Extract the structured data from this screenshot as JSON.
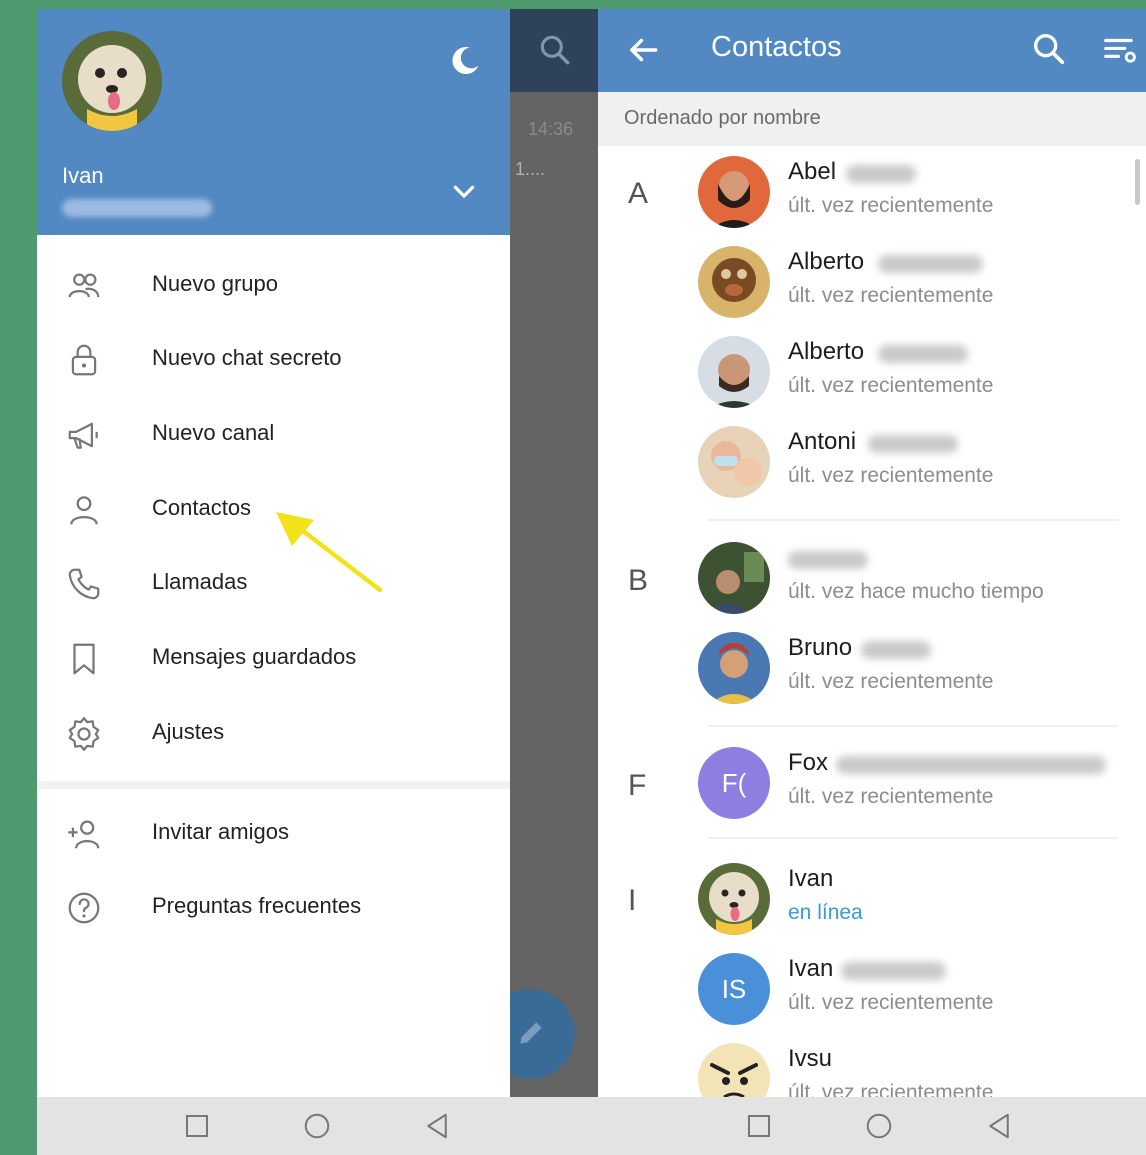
{
  "drawer": {
    "user_name": "Ivan",
    "menu_group_1": [
      {
        "label": "Nuevo grupo",
        "icon": "group-icon"
      },
      {
        "label": "Nuevo chat secreto",
        "icon": "lock-icon"
      },
      {
        "label": "Nuevo canal",
        "icon": "megaphone-icon"
      },
      {
        "label": "Contactos",
        "icon": "person-icon"
      },
      {
        "label": "Llamadas",
        "icon": "phone-icon"
      },
      {
        "label": "Mensajes guardados",
        "icon": "bookmark-icon"
      },
      {
        "label": "Ajustes",
        "icon": "gear-icon"
      }
    ],
    "menu_group_2": [
      {
        "label": "Invitar amigos",
        "icon": "add-person-icon"
      },
      {
        "label": "Preguntas frecuentes",
        "icon": "question-icon"
      }
    ]
  },
  "chat_peek": {
    "time": "14:36",
    "snippet": "1...."
  },
  "contacts": {
    "title": "Contactos",
    "sort_label": "Ordenado por nombre",
    "sections": [
      {
        "letter": "A",
        "items": [
          {
            "name": "Abel",
            "status": "últ. vez recientemente"
          },
          {
            "name": "Alberto",
            "status": "últ. vez recientemente"
          },
          {
            "name": "Alberto",
            "status": "últ. vez recientemente"
          },
          {
            "name": "Antoni",
            "status": "últ. vez recientemente"
          }
        ]
      },
      {
        "letter": "B",
        "items": [
          {
            "name": "",
            "status": "últ. vez hace mucho tiempo"
          },
          {
            "name": "Bruno",
            "status": "últ. vez recientemente"
          }
        ]
      },
      {
        "letter": "F",
        "items": [
          {
            "name": "Fox",
            "status": "últ. vez recientemente",
            "initials": "F(",
            "avatar_color": "#8e7ee0"
          }
        ]
      },
      {
        "letter": "I",
        "items": [
          {
            "name": "Ivan",
            "status": "en línea"
          },
          {
            "name": "Ivan",
            "status": "últ. vez recientemente",
            "initials": "IS",
            "avatar_color": "#4a90d9"
          },
          {
            "name": "Ivsu",
            "status": "últ. vez recientemente"
          }
        ]
      }
    ]
  },
  "colors": {
    "header_blue": "#5289c3",
    "online_blue": "#3a99d8",
    "annotation_arrow": "#f2e21a"
  }
}
